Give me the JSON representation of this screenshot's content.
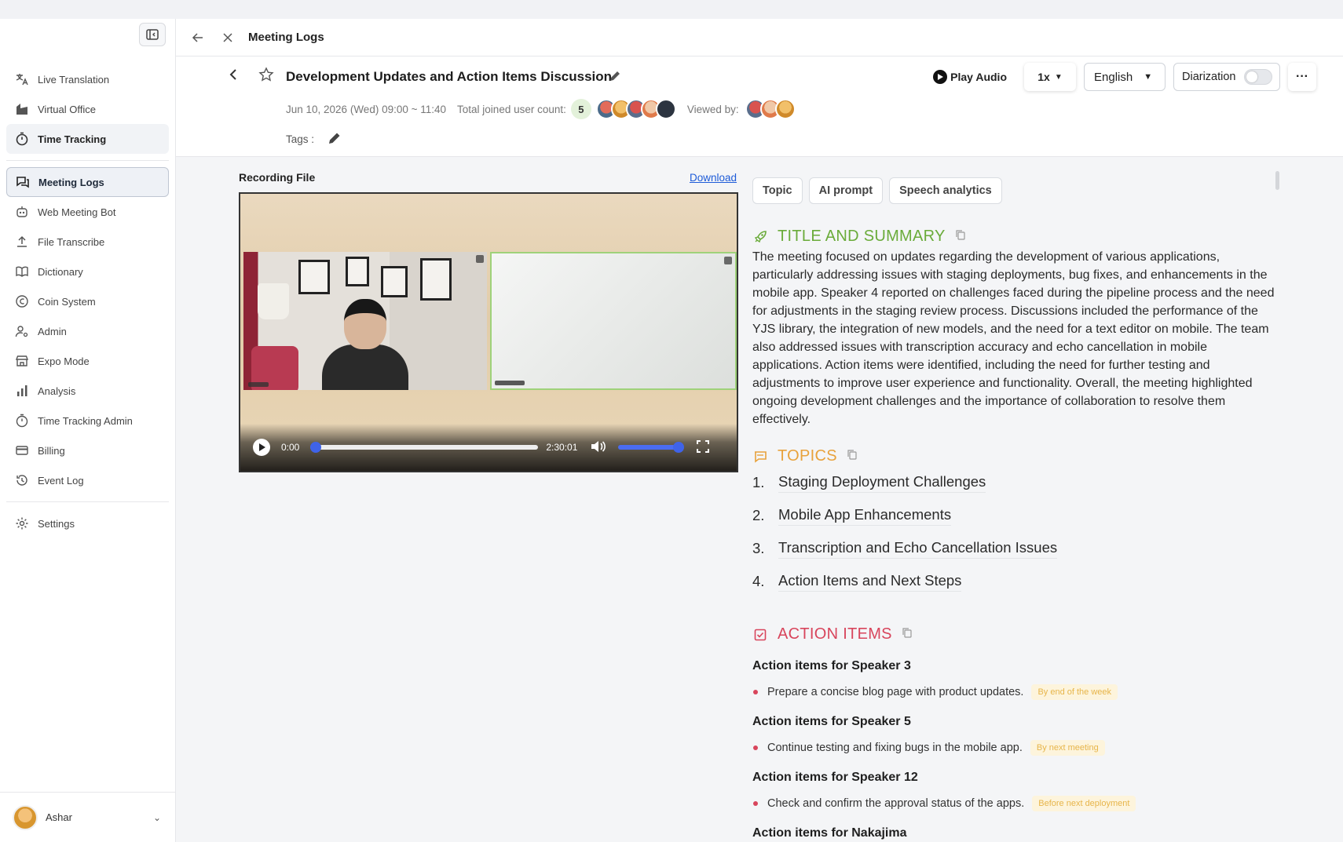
{
  "sidebar": {
    "items": [
      {
        "label": "Live Translation",
        "icon": "translate-icon"
      },
      {
        "label": "Virtual Office",
        "icon": "office-icon"
      },
      {
        "label": "Time Tracking",
        "icon": "timer-icon"
      },
      {
        "label": "Meeting Logs",
        "icon": "chat-log-icon"
      },
      {
        "label": "Web Meeting Bot",
        "icon": "bot-icon"
      },
      {
        "label": "File Transcribe",
        "icon": "upload-icon"
      },
      {
        "label": "Dictionary",
        "icon": "book-icon"
      },
      {
        "label": "Coin System",
        "icon": "coin-icon"
      },
      {
        "label": "Admin",
        "icon": "user-admin-icon"
      },
      {
        "label": "Expo Mode",
        "icon": "store-icon"
      },
      {
        "label": "Analysis",
        "icon": "bar-chart-icon"
      },
      {
        "label": "Time Tracking Admin",
        "icon": "timer-icon"
      },
      {
        "label": "Billing",
        "icon": "card-icon"
      },
      {
        "label": "Event Log",
        "icon": "history-icon"
      },
      {
        "label": "Settings",
        "icon": "gear-icon"
      }
    ],
    "active": "Meeting Logs",
    "user": {
      "name": "Ashar"
    }
  },
  "header": {
    "title": "Meeting Logs"
  },
  "meeting": {
    "title": "Development Updates and Action Items Discussion",
    "datetime": "Jun 10, 2026 (Wed) 09:00 ~ 11:40",
    "joined_label": "Total joined user count:",
    "joined_count": "5",
    "viewed_label": "Viewed by:",
    "tags_label": "Tags :"
  },
  "actions": {
    "play_audio": "Play Audio",
    "speed": "1x",
    "language": "English",
    "diarization": "Diarization",
    "diarization_on": false
  },
  "recording": {
    "label": "Recording File",
    "download": "Download",
    "time_now": "0:00",
    "time_total": "2:30:01",
    "progress": 0.0,
    "volume": 1.0
  },
  "tabs": [
    "Topic",
    "AI prompt",
    "Speech analytics"
  ],
  "summary": {
    "title": "TITLE AND SUMMARY",
    "color": "#6aab3a",
    "text": "The meeting focused on updates regarding the development of various applications, particularly addressing issues with staging deployments, bug fixes, and enhancements in the mobile app. Speaker 4 reported on challenges faced during the pipeline process and the need for adjustments in the staging review process. Discussions included the performance of the YJS library, the integration of new models, and the need for a text editor on mobile. The team also addressed issues with transcription accuracy and echo cancellation in mobile applications. Action items were identified, including the need for further testing and adjustments to improve user experience and functionality. Overall, the meeting highlighted ongoing development challenges and the importance of collaboration to resolve them effectively."
  },
  "topics": {
    "title": "TOPICS",
    "color": "#e8a23c",
    "items": [
      {
        "num": "1.",
        "text": "Staging Deployment Challenges"
      },
      {
        "num": "2.",
        "text": "Mobile App Enhancements"
      },
      {
        "num": "3.",
        "text": "Transcription and Echo Cancellation Issues"
      },
      {
        "num": "4.",
        "text": "Action Items and Next Steps"
      }
    ]
  },
  "action_items": {
    "title": "ACTION ITEMS",
    "color": "#d8455c",
    "groups": [
      {
        "heading": "Action items for Speaker 3",
        "item": "Prepare a concise blog page with product updates.",
        "due": "By end of the week"
      },
      {
        "heading": "Action items for Speaker 5",
        "item": "Continue testing and fixing bugs in the mobile app.",
        "due": "By next meeting"
      },
      {
        "heading": "Action items for Speaker 12",
        "item": "Check and confirm the approval status of the apps.",
        "due": "Before next deployment"
      },
      {
        "heading": "Action items for Nakajima",
        "item": "",
        "due": ""
      }
    ]
  }
}
